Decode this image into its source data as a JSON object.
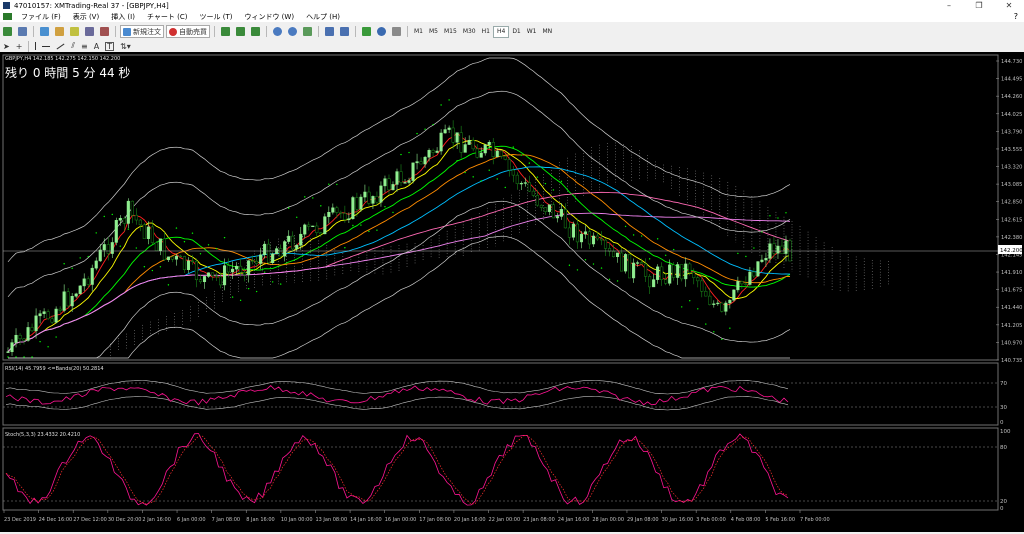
{
  "window": {
    "title": "47010157: XMTrading-Real 37 - [GBPJPY,H4]",
    "minimize": "–",
    "restore": "❐",
    "close": "✕"
  },
  "menu": {
    "items": [
      "ファイル (F)",
      "表示 (V)",
      "挿入 (I)",
      "チャート (C)",
      "ツール (T)",
      "ウィンドウ (W)",
      "ヘルプ (H)"
    ],
    "help_icon": "?"
  },
  "toolbar": {
    "new_order_label": "新規注文",
    "autotrade_label": "自動売買",
    "timeframes": [
      "M1",
      "M5",
      "M15",
      "M30",
      "H1",
      "H4",
      "D1",
      "W1",
      "MN"
    ],
    "active_timeframe": "H4",
    "tool_labels": {
      "text": "A",
      "label": "T"
    }
  },
  "chart": {
    "header": "GBPJPY,H4  142.185 142.275 142.150 142.200",
    "countdown": "残り 0 時間 5 分 44 秒",
    "current_price": "142.200",
    "price_ticks": [
      "144.730",
      "144.495",
      "144.260",
      "144.025",
      "143.790",
      "143.555",
      "143.320",
      "143.085",
      "142.850",
      "142.615",
      "142.380",
      "142.145",
      "141.910",
      "141.675",
      "141.440",
      "141.205",
      "140.970",
      "140.735"
    ],
    "date_ticks": [
      "23 Dec 2019",
      "24 Dec 16:00",
      "27 Dec 12:00",
      "30 Dec 20:00",
      "2 Jan 16:00",
      "6 Jan 00:00",
      "7 Jan 08:00",
      "8 Jan 16:00",
      "10 Jan 00:00",
      "13 Jan 08:00",
      "14 Jan 16:00",
      "16 Jan 00:00",
      "17 Jan 08:00",
      "20 Jan 16:00",
      "22 Jan 00:00",
      "23 Jan 08:00",
      "24 Jan 16:00",
      "28 Jan 00:00",
      "29 Jan 08:00",
      "30 Jan 16:00",
      "3 Feb 00:00",
      "4 Feb 08:00",
      "5 Feb 16:00",
      "7 Feb 00:00"
    ],
    "colors": {
      "bg": "#000000",
      "bull": "#90ee90",
      "bear": "#1a8a1a",
      "grid": "#808080",
      "axis_text": "#c0c0c0"
    }
  },
  "rsi": {
    "header": "RSI(14) 45.7959  <=Bands(20) 50.2814",
    "levels": [
      "70",
      "30",
      "0"
    ],
    "colors": {
      "line": "#ff1493",
      "band": "#c0c0c0"
    }
  },
  "stoch": {
    "header": "Stoch(5,3,3) 23.4332 20.4210",
    "levels": [
      "100",
      "80",
      "20",
      "0"
    ],
    "colors": {
      "main": "#ff1493",
      "signal": "#ff3030"
    }
  }
}
